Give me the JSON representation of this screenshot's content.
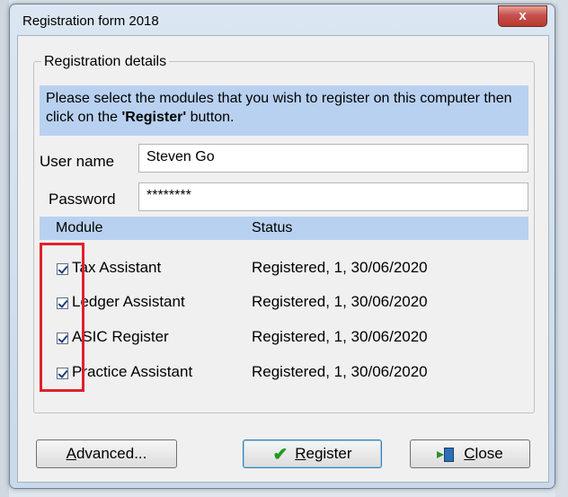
{
  "window": {
    "title": "Registration form 2018",
    "close_glyph": "x"
  },
  "group": {
    "title": "Registration details"
  },
  "info": {
    "text_before": "Please select the modules that you wish to register on this computer then click on the ",
    "bold_text": "'Register'",
    "text_after": " button."
  },
  "fields": {
    "username_label": "User name",
    "username_value": "Steven Go",
    "password_label": "Password",
    "password_value": "********"
  },
  "table": {
    "col_module": "Module",
    "col_status": "Status",
    "rows": [
      {
        "module": "Tax Assistant",
        "status": "Registered, 1, 30/06/2020",
        "checked": true
      },
      {
        "module": "Ledger Assistant",
        "status": "Registered, 1, 30/06/2020",
        "checked": true
      },
      {
        "module": "ASIC Register",
        "status": "Registered, 1, 30/06/2020",
        "checked": true
      },
      {
        "module": "Practice Assistant",
        "status": "Registered, 1, 30/06/2020",
        "checked": true
      }
    ]
  },
  "buttons": {
    "advanced_first": "A",
    "advanced_rest": "dvanced...",
    "register_first": "R",
    "register_rest": "egister",
    "close_first": "C",
    "close_rest": "lose"
  },
  "colors": {
    "info_background": "#b9d1f0",
    "highlight_border": "#e0212c",
    "check_green": "#1e9a1e"
  }
}
